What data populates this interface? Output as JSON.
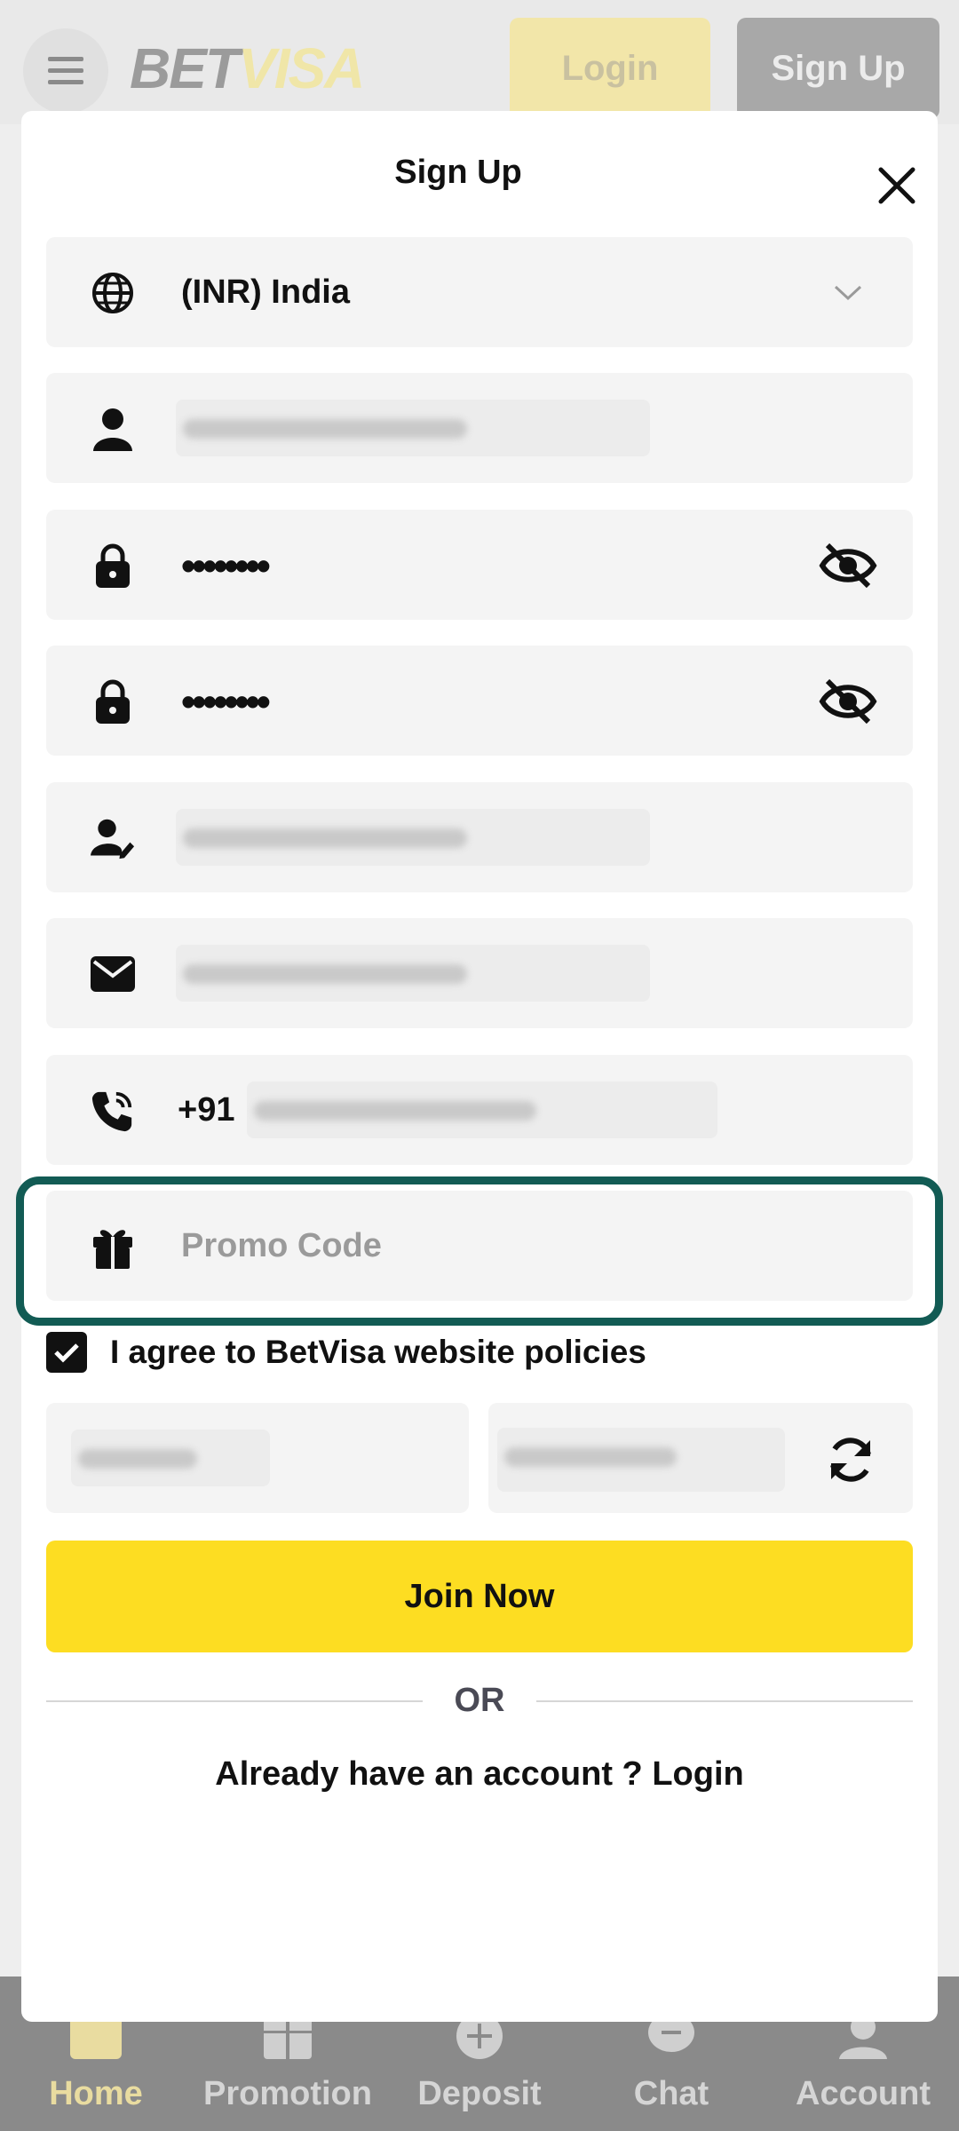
{
  "header": {
    "logo_part1": "BET",
    "logo_part2": "VISA",
    "login_label": "Login",
    "signup_label": "Sign Up"
  },
  "bottom_nav": {
    "items": [
      {
        "label": "Home",
        "icon": "home-icon",
        "active": true
      },
      {
        "label": "Promotion",
        "icon": "gift-icon"
      },
      {
        "label": "Deposit",
        "icon": "plus-circle-icon"
      },
      {
        "label": "Chat",
        "icon": "chat-icon"
      },
      {
        "label": "Account",
        "icon": "person-icon"
      }
    ]
  },
  "modal": {
    "title": "Sign Up",
    "currency_select": {
      "value": "(INR) India",
      "icon": "globe-icon"
    },
    "password": {
      "value": "••••••••"
    },
    "confirm_password": {
      "value": "••••••••"
    },
    "phone": {
      "prefix": "+91"
    },
    "promo": {
      "placeholder": "Promo Code",
      "icon": "gift-icon"
    },
    "agree_text": "I agree to BetVisa website policies",
    "agree_checked": true,
    "join_label": "Join Now",
    "or_text": "OR",
    "already_text": "Already have an account ? Login"
  },
  "colors": {
    "accent": "#fddd22",
    "highlight_border": "#125b54",
    "field_bg": "#f4f4f4"
  }
}
